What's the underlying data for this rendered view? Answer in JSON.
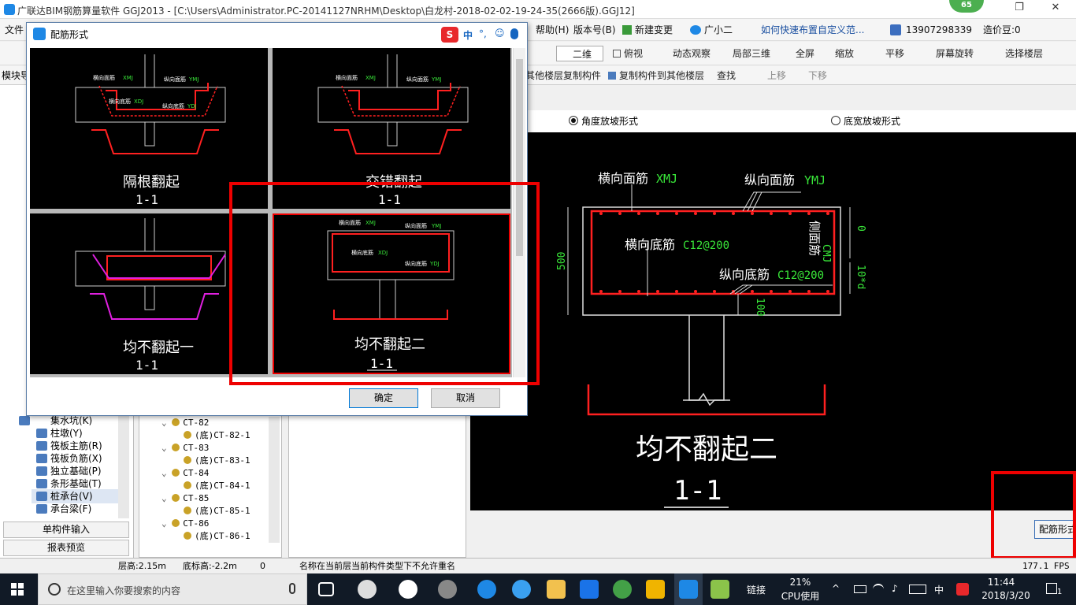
{
  "app": {
    "title": "广联达BIM钢筋算量软件 GGJ2013 - [C:\\Users\\Administrator.PC-20141127NRHM\\Desktop\\白龙村-2018-02-02-19-24-35(2666版).GGJ12]",
    "badge": "65"
  },
  "menu": {
    "file": "文件",
    "help": "帮助(H)",
    "version": "版本号(B)",
    "new_change": "新建变更",
    "assistant": "广小二",
    "link": "如何快速布置自定义范...",
    "phone": "13907298339",
    "coins": "造价豆:0"
  },
  "toolbar2": {
    "view2d": "二维",
    "top_view": "俯视",
    "dynamic": "动态观察",
    "partial3d": "局部三维",
    "fullscreen": "全屏",
    "zoom": "缩放",
    "pan": "平移",
    "rotate": "屏幕旋转",
    "select_floor": "选择楼层"
  },
  "toolbar3": {
    "copy_from": "其他楼层复制构件",
    "copy_to": "复制构件到其他楼层",
    "find": "查找",
    "up": "上移",
    "down": "下移"
  },
  "left": {
    "module": "模块导",
    "items": [
      "集水坑(K)",
      "柱墩(Y)",
      "筏板主筋(R)",
      "筏板负筋(X)",
      "独立基础(P)",
      "条形基础(T)",
      "桩承台(V)",
      "承台梁(F)"
    ],
    "btn_single": "单构件输入",
    "btn_report": "报表预览"
  },
  "tree": {
    "rows": [
      {
        "label": "CT-82",
        "level": 0
      },
      {
        "label": "(底)CT-82-1",
        "level": 1
      },
      {
        "label": "CT-83",
        "level": 0
      },
      {
        "label": "(底)CT-83-1",
        "level": 1
      },
      {
        "label": "CT-84",
        "level": 0
      },
      {
        "label": "(底)CT-84-1",
        "level": 1
      },
      {
        "label": "CT-85",
        "level": 0
      },
      {
        "label": "(底)CT-85-1",
        "level": 1
      },
      {
        "label": "CT-86",
        "level": 0
      },
      {
        "label": "(底)CT-86-1",
        "level": 1
      }
    ]
  },
  "right": {
    "radio1": "角度放坡形式",
    "radio2": "底宽放坡形式",
    "btn": "配筋形式"
  },
  "preview": {
    "top_bar": "横向面筋",
    "top_bar_code": "XMJ",
    "long_top": "纵向面筋",
    "long_top_code": "YMJ",
    "bot_bar": "横向底筋",
    "bot_bar_code": "C12@200",
    "long_bot": "纵向底筋",
    "long_bot_code": "C12@200",
    "side": "侧面筋",
    "side_code": "CMJ",
    "dim_500": "500",
    "dim_0": "0",
    "dim_10d": "10*d",
    "dim_100": "100",
    "caption": "均不翻起二",
    "section": "1-1"
  },
  "dialog": {
    "title": "配筋形式",
    "ime": [
      "中",
      "°,",
      "☺",
      "🎤"
    ],
    "ime_s": "S",
    "cells": [
      {
        "name": "隔根翻起",
        "section": "1-1"
      },
      {
        "name": "交错翻起",
        "section": "1-1"
      },
      {
        "name": "均不翻起一",
        "section": "1-1"
      },
      {
        "name": "均不翻起二",
        "section": "1-1"
      }
    ],
    "mini": {
      "heng_mian": "横向面筋",
      "zong_mian": "纵向面筋",
      "heng_di": "横向底筋",
      "zong_di": "纵向底筋",
      "xmj": "XMJ",
      "ymj": "YMJ",
      "xdj": "XDJ",
      "ydj": "YDJ"
    },
    "ok": "确定",
    "cancel": "取消"
  },
  "status": {
    "floor_height": "层高:2.15m",
    "base_elev": "底标高:-2.2m",
    "zero": "0",
    "message": "名称在当前层当前构件类型下不允许重名",
    "fps": "177.1 FPS"
  },
  "taskbar": {
    "search_placeholder": "在这里输入你要搜索的内容",
    "link": "链接",
    "cpu_pct": "21%",
    "cpu_label": "CPU使用",
    "ime": "中",
    "time": "11:44",
    "date": "2018/3/20",
    "notif": "1"
  },
  "colors": {
    "rebar": "#ff2020",
    "label": "#ffffff",
    "code": "#39e639",
    "highlight": "#e00000"
  }
}
